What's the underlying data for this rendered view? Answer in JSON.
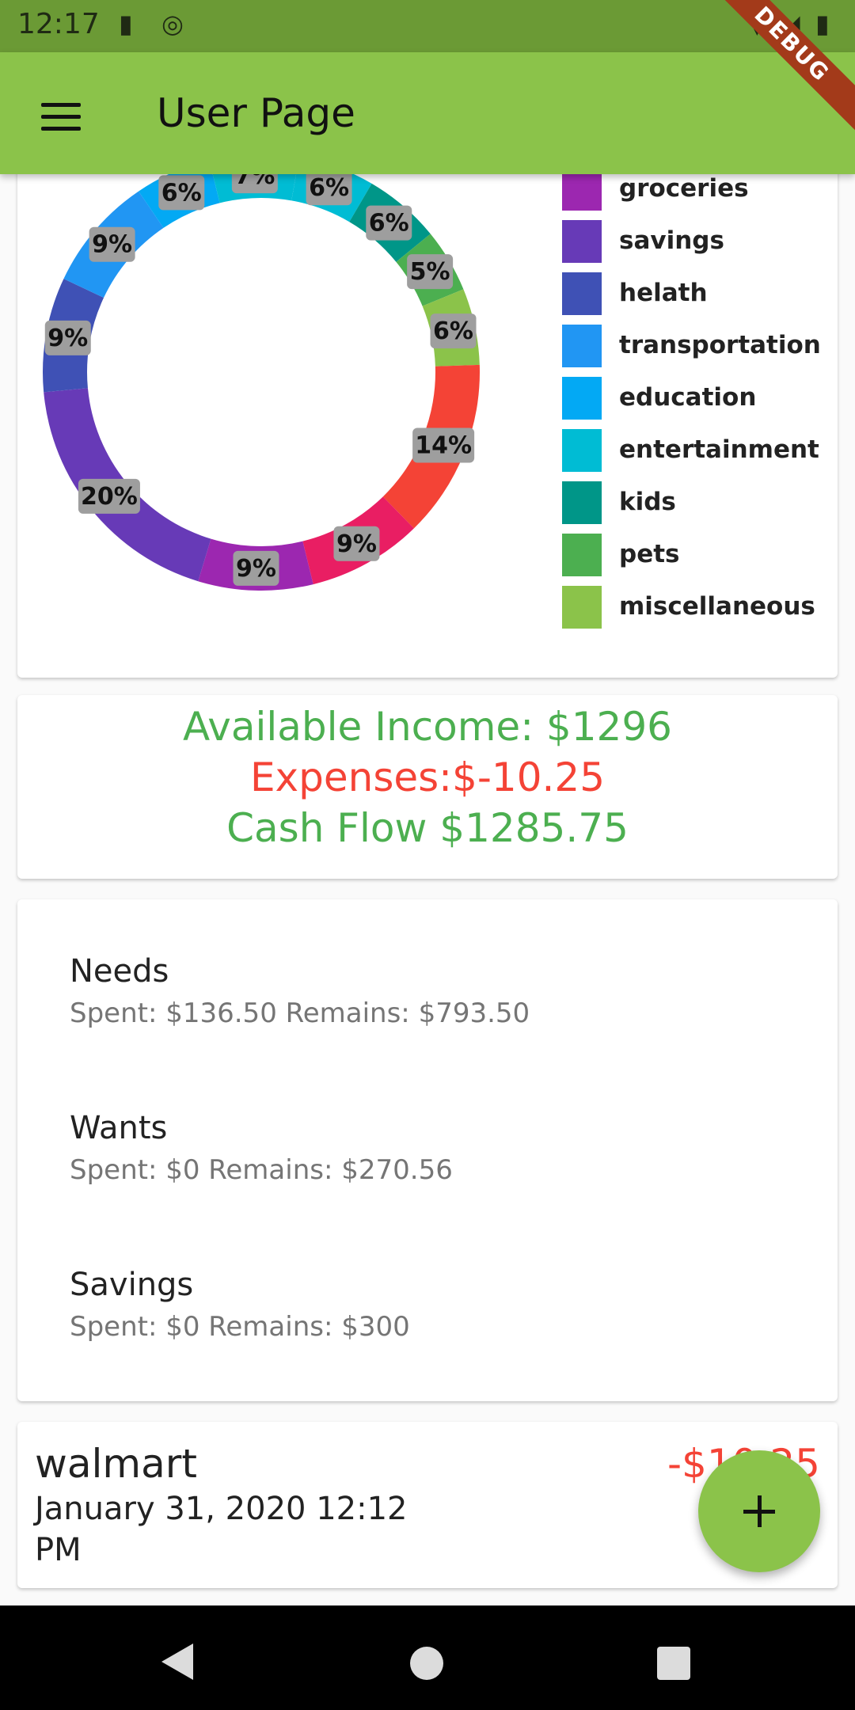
{
  "status": {
    "time": "12:17",
    "icons": [
      "sd-card-icon",
      "sync-icon",
      "wifi-icon",
      "signal-icon",
      "battery-icon"
    ],
    "debug_banner": "DEBUG"
  },
  "app_bar": {
    "title": "User Page",
    "menu_icon": "hamburger-menu-icon"
  },
  "chart_data": {
    "type": "pie",
    "slices": [
      {
        "name": "",
        "value": 6,
        "label": "6%",
        "color": "#00bcd4"
      },
      {
        "name": "kids",
        "value": 6,
        "label": "6%",
        "color": "#009688"
      },
      {
        "name": "pets",
        "value": 5,
        "label": "5%",
        "color": "#4caf50"
      },
      {
        "name": "miscellaneous",
        "value": 6,
        "label": "6%",
        "color": "#8bc34a"
      },
      {
        "name": "",
        "value": 14,
        "label": "14%",
        "color": "#f44336"
      },
      {
        "name": "",
        "value": 9,
        "label": "9%",
        "color": "#e91e63"
      },
      {
        "name": "groceries",
        "value": 9,
        "label": "9%",
        "color": "#9c27b0"
      },
      {
        "name": "savings",
        "value": 20,
        "label": "20%",
        "color": "#673ab7"
      },
      {
        "name": "helath",
        "value": 9,
        "label": "9%",
        "color": "#3f51b5"
      },
      {
        "name": "transportation",
        "value": 9,
        "label": "9%",
        "color": "#2196f3"
      },
      {
        "name": "education",
        "value": 6,
        "label": "6%",
        "color": "#03a9f4"
      },
      {
        "name": "entertainment",
        "value": 7,
        "label": "7%",
        "color": "#00bcd4"
      }
    ],
    "legend": [
      {
        "label": "",
        "color": "#e91e63"
      },
      {
        "label": "groceries",
        "color": "#9c27b0"
      },
      {
        "label": "savings",
        "color": "#673ab7"
      },
      {
        "label": "helath",
        "color": "#3f51b5"
      },
      {
        "label": "transportation",
        "color": "#2196f3"
      },
      {
        "label": "education",
        "color": "#03a9f4"
      },
      {
        "label": "entertainment",
        "color": "#00bcd4"
      },
      {
        "label": "kids",
        "color": "#009688"
      },
      {
        "label": "pets",
        "color": "#4caf50"
      },
      {
        "label": "miscellaneous",
        "color": "#8bc34a"
      }
    ],
    "legend_position": "right"
  },
  "summary": {
    "income": "Available Income: $1296",
    "expenses": "Expenses:$-10.25",
    "cash_flow": "Cash Flow $1285.75"
  },
  "budget": [
    {
      "name": "Needs",
      "detail": "Spent: $136.50  Remains: $793.50"
    },
    {
      "name": "Wants",
      "detail": "Spent: $0  Remains: $270.56"
    },
    {
      "name": "Savings",
      "detail": "Spent: $0  Remains: $300"
    }
  ],
  "transaction": {
    "title": "walmart",
    "date": "January 31, 2020 12:12 PM",
    "amount": "-$10.25"
  },
  "fab": {
    "icon": "plus-icon"
  },
  "nav": {
    "icons": [
      "back-icon",
      "home-icon",
      "recents-icon"
    ]
  }
}
